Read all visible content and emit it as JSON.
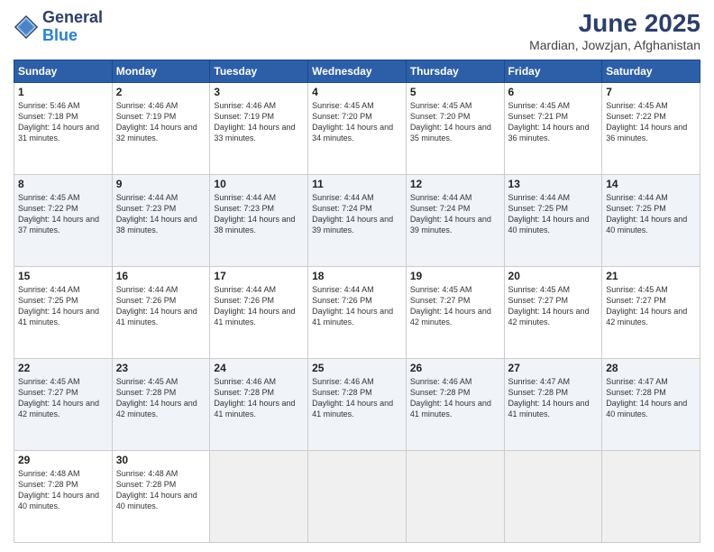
{
  "logo": {
    "general": "General",
    "blue": "Blue"
  },
  "title": "June 2025",
  "subtitle": "Mardian, Jowzjan, Afghanistan",
  "days": [
    "Sunday",
    "Monday",
    "Tuesday",
    "Wednesday",
    "Thursday",
    "Friday",
    "Saturday"
  ],
  "weeks": [
    [
      {
        "day": "1",
        "rise": "5:46 AM",
        "set": "7:18 PM",
        "daylight": "14 hours and 31 minutes."
      },
      {
        "day": "2",
        "rise": "4:46 AM",
        "set": "7:19 PM",
        "daylight": "14 hours and 32 minutes."
      },
      {
        "day": "3",
        "rise": "4:46 AM",
        "set": "7:19 PM",
        "daylight": "14 hours and 33 minutes."
      },
      {
        "day": "4",
        "rise": "4:45 AM",
        "set": "7:20 PM",
        "daylight": "14 hours and 34 minutes."
      },
      {
        "day": "5",
        "rise": "4:45 AM",
        "set": "7:20 PM",
        "daylight": "14 hours and 35 minutes."
      },
      {
        "day": "6",
        "rise": "4:45 AM",
        "set": "7:21 PM",
        "daylight": "14 hours and 36 minutes."
      },
      {
        "day": "7",
        "rise": "4:45 AM",
        "set": "7:22 PM",
        "daylight": "14 hours and 36 minutes."
      }
    ],
    [
      {
        "day": "8",
        "rise": "4:45 AM",
        "set": "7:22 PM",
        "daylight": "14 hours and 37 minutes."
      },
      {
        "day": "9",
        "rise": "4:44 AM",
        "set": "7:23 PM",
        "daylight": "14 hours and 38 minutes."
      },
      {
        "day": "10",
        "rise": "4:44 AM",
        "set": "7:23 PM",
        "daylight": "14 hours and 38 minutes."
      },
      {
        "day": "11",
        "rise": "4:44 AM",
        "set": "7:24 PM",
        "daylight": "14 hours and 39 minutes."
      },
      {
        "day": "12",
        "rise": "4:44 AM",
        "set": "7:24 PM",
        "daylight": "14 hours and 39 minutes."
      },
      {
        "day": "13",
        "rise": "4:44 AM",
        "set": "7:25 PM",
        "daylight": "14 hours and 40 minutes."
      },
      {
        "day": "14",
        "rise": "4:44 AM",
        "set": "7:25 PM",
        "daylight": "14 hours and 40 minutes."
      }
    ],
    [
      {
        "day": "15",
        "rise": "4:44 AM",
        "set": "7:25 PM",
        "daylight": "14 hours and 41 minutes."
      },
      {
        "day": "16",
        "rise": "4:44 AM",
        "set": "7:26 PM",
        "daylight": "14 hours and 41 minutes."
      },
      {
        "day": "17",
        "rise": "4:44 AM",
        "set": "7:26 PM",
        "daylight": "14 hours and 41 minutes."
      },
      {
        "day": "18",
        "rise": "4:44 AM",
        "set": "7:26 PM",
        "daylight": "14 hours and 41 minutes."
      },
      {
        "day": "19",
        "rise": "4:45 AM",
        "set": "7:27 PM",
        "daylight": "14 hours and 42 minutes."
      },
      {
        "day": "20",
        "rise": "4:45 AM",
        "set": "7:27 PM",
        "daylight": "14 hours and 42 minutes."
      },
      {
        "day": "21",
        "rise": "4:45 AM",
        "set": "7:27 PM",
        "daylight": "14 hours and 42 minutes."
      }
    ],
    [
      {
        "day": "22",
        "rise": "4:45 AM",
        "set": "7:27 PM",
        "daylight": "14 hours and 42 minutes."
      },
      {
        "day": "23",
        "rise": "4:45 AM",
        "set": "7:28 PM",
        "daylight": "14 hours and 42 minutes."
      },
      {
        "day": "24",
        "rise": "4:46 AM",
        "set": "7:28 PM",
        "daylight": "14 hours and 41 minutes."
      },
      {
        "day": "25",
        "rise": "4:46 AM",
        "set": "7:28 PM",
        "daylight": "14 hours and 41 minutes."
      },
      {
        "day": "26",
        "rise": "4:46 AM",
        "set": "7:28 PM",
        "daylight": "14 hours and 41 minutes."
      },
      {
        "day": "27",
        "rise": "4:47 AM",
        "set": "7:28 PM",
        "daylight": "14 hours and 41 minutes."
      },
      {
        "day": "28",
        "rise": "4:47 AM",
        "set": "7:28 PM",
        "daylight": "14 hours and 40 minutes."
      }
    ],
    [
      {
        "day": "29",
        "rise": "4:48 AM",
        "set": "7:28 PM",
        "daylight": "14 hours and 40 minutes."
      },
      {
        "day": "30",
        "rise": "4:48 AM",
        "set": "7:28 PM",
        "daylight": "14 hours and 40 minutes."
      },
      null,
      null,
      null,
      null,
      null
    ]
  ]
}
